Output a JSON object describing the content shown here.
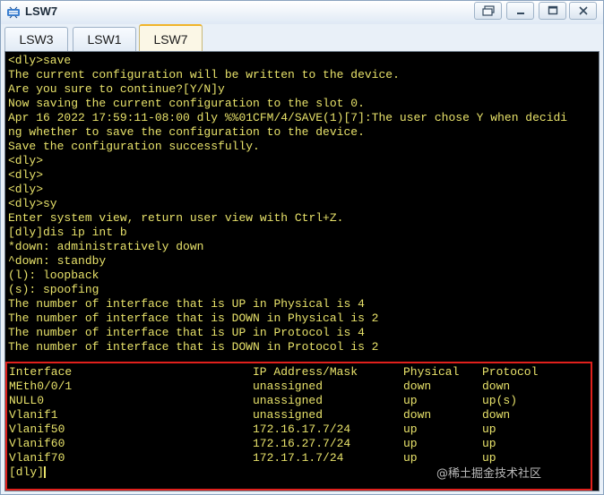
{
  "window": {
    "title": "LSW7"
  },
  "tabs": [
    {
      "label": "LSW3"
    },
    {
      "label": "LSW1"
    },
    {
      "label": "LSW7"
    }
  ],
  "terminal": {
    "lines": [
      "<dly>save",
      "The current configuration will be written to the device.",
      "Are you sure to continue?[Y/N]y",
      "Now saving the current configuration to the slot 0.",
      "Apr 16 2022 17:59:11-08:00 dly %%01CFM/4/SAVE(1)[7]:The user chose Y when decidi",
      "ng whether to save the configuration to the device.",
      "Save the configuration successfully.",
      "<dly>",
      "<dly>",
      "<dly>",
      "<dly>sy",
      "Enter system view, return user view with Ctrl+Z.",
      "[dly]dis ip int b",
      "*down: administratively down",
      "^down: standby",
      "(l): loopback",
      "(s): spoofing",
      "The number of interface that is UP in Physical is 4",
      "The number of interface that is DOWN in Physical is 2",
      "The number of interface that is UP in Protocol is 4",
      "The number of interface that is DOWN in Protocol is 2"
    ],
    "table": {
      "headers": [
        "Interface",
        "IP Address/Mask",
        "Physical",
        "Protocol"
      ],
      "rows": [
        [
          "MEth0/0/1",
          "unassigned",
          "down",
          "down"
        ],
        [
          "NULL0",
          "unassigned",
          "up",
          "up(s)"
        ],
        [
          "Vlanif1",
          "unassigned",
          "down",
          "down"
        ],
        [
          "Vlanif50",
          "172.16.17.7/24",
          "up",
          "up"
        ],
        [
          "Vlanif60",
          "172.16.27.7/24",
          "up",
          "up"
        ],
        [
          "Vlanif70",
          "172.17.1.7/24",
          "up",
          "up"
        ]
      ]
    },
    "prompt": "[dly]"
  },
  "watermark": "@稀土掘金技术社区",
  "colors": {
    "terminal_bg": "#000000",
    "terminal_text": "#e8e26a",
    "highlight_border": "#e0201c"
  }
}
